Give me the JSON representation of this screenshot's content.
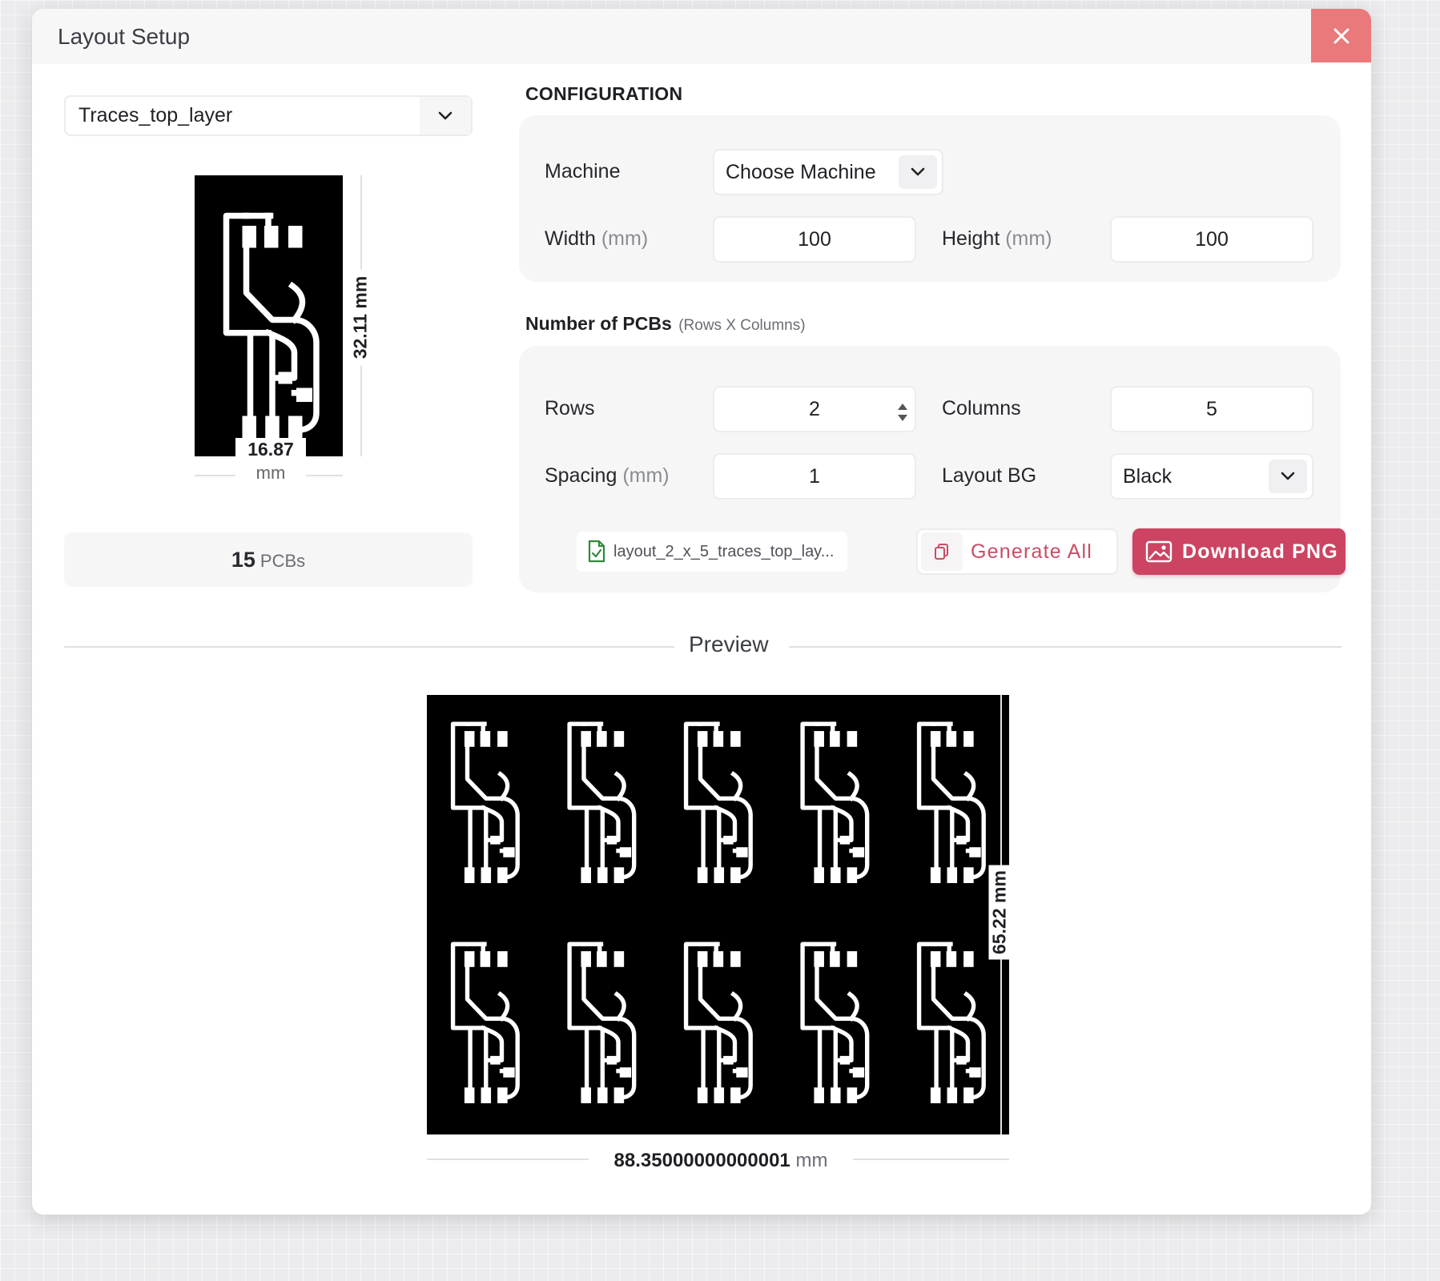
{
  "dialog": {
    "title": "Layout Setup",
    "close_icon": "close-icon",
    "accent_color": "#cc4462"
  },
  "layer_select": {
    "value": "Traces_top_layer",
    "icon": "chevron-down-icon"
  },
  "single_pcb": {
    "width_value": "16.87",
    "width_unit": "mm",
    "height_label": "32.11 mm"
  },
  "pcb_count": {
    "value": "15",
    "unit": "PCBs"
  },
  "configuration": {
    "title": "CONFIGURATION",
    "machine_label": "Machine",
    "machine_value": "Choose Machine",
    "width_label": "Width",
    "width_unit": "(mm)",
    "width_value": "100",
    "height_label": "Height",
    "height_unit": "(mm)",
    "height_value": "100"
  },
  "pcb_grid": {
    "title": "Number of PCBs",
    "subtitle": "(Rows X Columns)",
    "rows_label": "Rows",
    "rows_value": "2",
    "columns_label": "Columns",
    "columns_value": "5",
    "spacing_label": "Spacing",
    "spacing_unit": "(mm)",
    "spacing_value": "1",
    "bg_label": "Layout BG",
    "bg_value": "Black"
  },
  "actions": {
    "file_name": "layout_2_x_5_traces_top_lay...",
    "generate_label": "Generate All",
    "download_label": "Download PNG"
  },
  "preview": {
    "title": "Preview",
    "height_label": "65.22 mm",
    "width_value": "88.35000000000001",
    "width_unit": "mm",
    "rows": 2,
    "columns": 5
  }
}
